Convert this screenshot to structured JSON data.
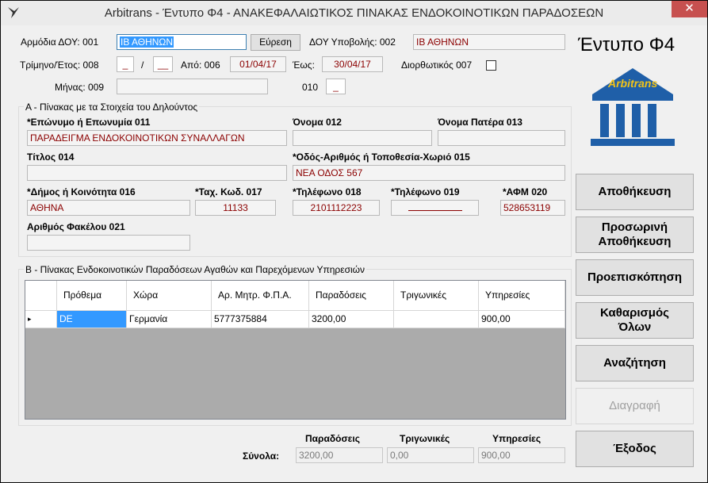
{
  "window": {
    "title": "Arbitrans - Έντυπο Φ4 - ΑΝΑΚΕΦΑΛΑΙΩΤΙΚΟΣ ΠΙΝΑΚΑΣ ΕΝΔΟΚΟΙΝΟΤΙΚΩΝ ΠΑΡΑΔΟΣΕΩΝ",
    "close_glyph": "✕",
    "icon": "bird-icon"
  },
  "header": {
    "doy_label": "Αρμόδια ΔΟΥ: 001",
    "doy_value": "ΙΒ ΑΘΗΝΩΝ",
    "search_button": "Εύρεση",
    "submit_doy_label": "ΔΟΥ Υποβολής: 002",
    "submit_doy_value": "ΙΒ ΑΘΗΝΩΝ",
    "quarter_label": "Τρίμηνο/Έτος: 008",
    "quarter_value": "_",
    "slash": "/",
    "year_value": "__",
    "from_label": "Από: 006",
    "from_value": "01/04/17",
    "to_label": "Έως:",
    "to_value": "30/04/17",
    "corrective_label": "Διορθωτικός 007",
    "month_label": "Μήνας: 009",
    "month_value": "",
    "code010_label": "010",
    "code010_value": "_"
  },
  "brand": {
    "form_title": "Έντυπο Φ4",
    "logo_text": "Arbitrans",
    "colors": {
      "logo_blue": "#1f5fa8",
      "logo_gold": "#f2c318",
      "field_text": "#8b0000"
    }
  },
  "declarant": {
    "group_title": "Α - Πίνακας με τα Στοιχεία του Δηλούντος",
    "surname_label": "*Επώνυμο ή Επωνυμία 011",
    "surname_value": "ΠΑΡΑΔΕΙΓΜΑ ΕΝΔΟΚΟΙΝΟΤΙΚΩΝ ΣΥΝΑΛΛΑΓΩΝ",
    "name_label": "Όνομα 012",
    "name_value": "",
    "father_label": "Όνομα Πατέρα 013",
    "father_value": "",
    "title_label": "Τίτλος 014",
    "title_value": "",
    "street_label": "*Οδός-Αριθμός ή Τοποθεσία-Χωριό 015",
    "street_value": "ΝΕΑ ΟΔΟΣ 567",
    "municipality_label": "*Δήμος ή Κοινότητα 016",
    "municipality_value": "ΑΘΗΝΑ",
    "postcode_label": "*Ταχ. Κωδ. 017",
    "postcode_value": "11133",
    "phone1_label": "*Τηλέφωνο 018",
    "phone1_value": "2101112223",
    "phone2_label": "*Τηλέφωνο 019",
    "phone2_value": "",
    "afm_label": "*ΑΦΜ 020",
    "afm_value": "528653119",
    "folder_label": "Αριθμός Φακέλου 021",
    "folder_value": ""
  },
  "deliveries": {
    "group_title": "Β - Πίνακας Ενδοκοινοτικών Παραδόσεων Αγαθών και Παρεχόμενων Υπηρεσιών",
    "columns": [
      "Πρόθεμα",
      "Χώρα",
      "Αρ. Μητρ. Φ.Π.Α.",
      "Παραδόσεις",
      "Τριγωνικές",
      "Υπηρεσίες"
    ],
    "row_indicator": "▸",
    "rows": [
      {
        "prefix": "DE",
        "country": "Γερμανία",
        "vat": "5777375884",
        "deliveries": "3200,00",
        "triangular": "",
        "services": "900,00"
      }
    ]
  },
  "totals": {
    "label": "Σύνολα:",
    "deliveries_label": "Παραδόσεις",
    "triangular_label": "Τριγωνικές",
    "services_label": "Υπηρεσίες",
    "deliveries_value": "3200,00",
    "triangular_value": "0,00",
    "services_value": "900,00"
  },
  "actions": {
    "save": "Αποθήκευση",
    "temp_save_line1": "Προσωρινή",
    "temp_save_line2": "Αποθήκευση",
    "preview": "Προεπισκόπηση",
    "clear_line1": "Καθαρισμός",
    "clear_line2": "Όλων",
    "search": "Αναζήτηση",
    "delete": "Διαγραφή",
    "exit": "Έξοδος"
  }
}
